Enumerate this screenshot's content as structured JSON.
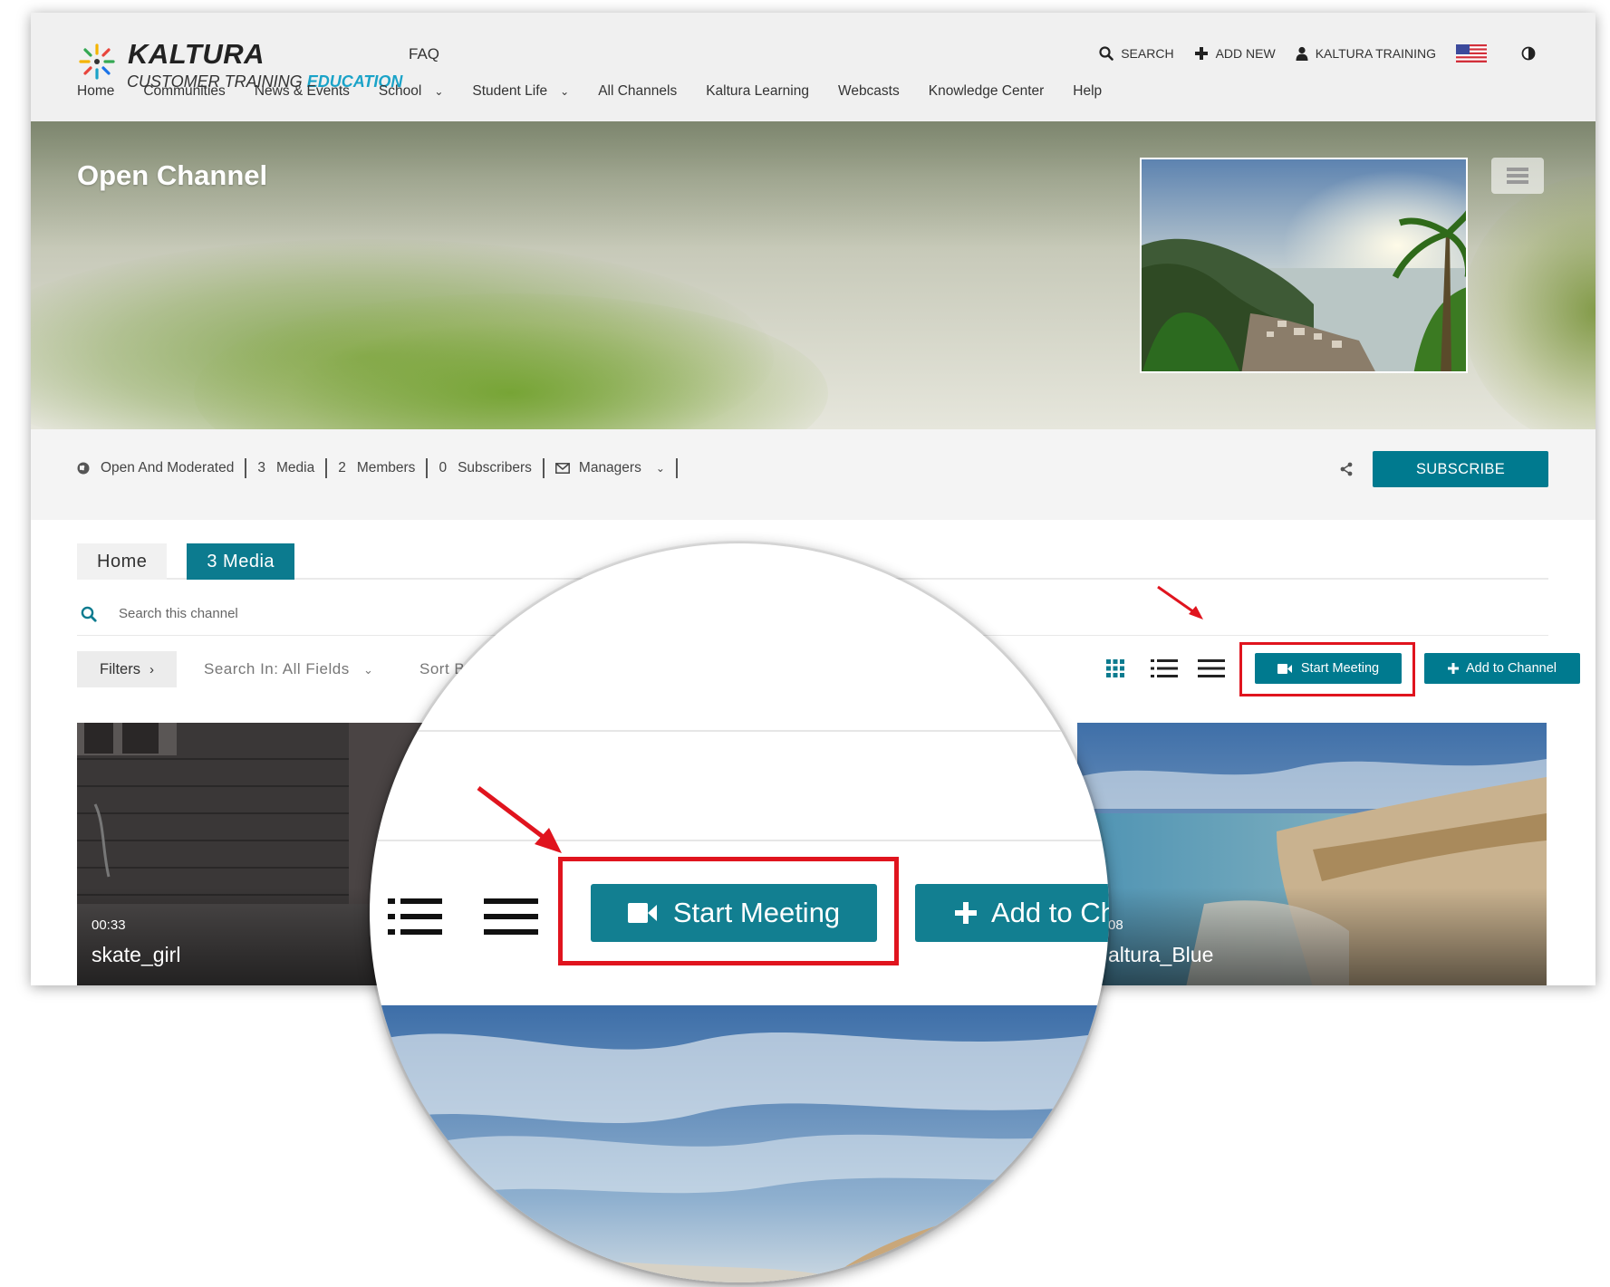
{
  "header": {
    "logo_title": "KALTURA",
    "logo_subtitle": "CUSTOMER TRAINING",
    "logo_subtitle_accent": "EDUCATION",
    "faq": "FAQ",
    "utility": {
      "search": "SEARCH",
      "add_new": "ADD NEW",
      "user": "KALTURA TRAINING",
      "flag_icon": "us-flag-icon",
      "contrast_icon": "contrast-icon"
    },
    "nav": [
      "Home",
      "Communities",
      "News & Events",
      "School",
      "Student Life",
      "All Channels",
      "Kaltura Learning",
      "Webcasts",
      "Knowledge Center",
      "Help"
    ]
  },
  "banner": {
    "title": "Open Channel"
  },
  "info": {
    "privacy": "Open And Moderated",
    "media_count": "3",
    "media_label": "Media",
    "members_count": "2",
    "members_label": "Members",
    "subscribers_count": "0",
    "subscribers_label": "Subscribers",
    "managers_label": "Managers",
    "subscribe_label": "SUBSCRIBE"
  },
  "tabs": [
    {
      "label": "Home",
      "active": false
    },
    {
      "label": "3 Media",
      "active": true
    }
  ],
  "search": {
    "placeholder": "Search this channel"
  },
  "toolbar": {
    "filters_label": "Filters",
    "search_in_label": "Search In: All Fields",
    "sort_label": "Sort B",
    "start_meeting_label": "Start Meeting",
    "add_to_channel_label": "Add to Channel"
  },
  "media": [
    {
      "duration": "00:33",
      "title": "skate_girl"
    },
    {
      "duration": "08",
      "title": "altura_Blue"
    }
  ],
  "magnifier": {
    "start_meeting_label": "Start Meeting",
    "add_to_channel_label": "Add to Ch"
  },
  "colors": {
    "accent": "#007a8f",
    "highlight": "#e0141e",
    "logo_accent": "#1aa3c8"
  }
}
